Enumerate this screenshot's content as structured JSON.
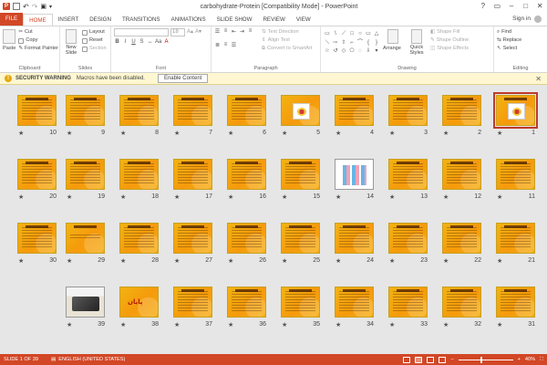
{
  "window": {
    "title": "carbohydrate-Protein [Compatibility Mode] - PowerPoint",
    "controls": [
      "?",
      "▭",
      "–",
      "□",
      "✕"
    ]
  },
  "tabs": [
    "FILE",
    "HOME",
    "INSERT",
    "DESIGN",
    "TRANSITIONS",
    "ANIMATIONS",
    "SLIDE SHOW",
    "REVIEW",
    "VIEW"
  ],
  "active_tab": "HOME",
  "account": {
    "signin": "Sign in"
  },
  "ribbon": {
    "clipboard": {
      "label": "Clipboard",
      "paste": "Paste",
      "cut": "Cut",
      "copy": "Copy",
      "format_painter": "Format Painter"
    },
    "slides": {
      "label": "Slides",
      "new_slide": "New Slide",
      "layout": "Layout",
      "reset": "Reset",
      "section": "Section"
    },
    "font": {
      "label": "Font",
      "size": "18"
    },
    "paragraph": {
      "label": "Paragraph",
      "text_direction": "Text Direction",
      "align_text": "Align Text",
      "convert_smartart": "Convert to SmartArt"
    },
    "drawing": {
      "label": "Drawing",
      "arrange": "Arrange",
      "quick_styles": "Quick Styles",
      "shape_fill": "Shape Fill",
      "shape_outline": "Shape Outline",
      "shape_effects": "Shape Effects"
    },
    "editing": {
      "label": "Editing",
      "find": "Find",
      "replace": "Replace",
      "select": "Select"
    }
  },
  "security_bar": {
    "title": "SECURITY WARNING",
    "message": "Macros have been disabled.",
    "button": "Enable Content"
  },
  "slides": [
    {
      "n": "1",
      "kind": "picture-title",
      "selected": true
    },
    {
      "n": "2",
      "kind": "text"
    },
    {
      "n": "3",
      "kind": "text"
    },
    {
      "n": "4",
      "kind": "text"
    },
    {
      "n": "5",
      "kind": "picture"
    },
    {
      "n": "6",
      "kind": "text"
    },
    {
      "n": "7",
      "kind": "text"
    },
    {
      "n": "8",
      "kind": "text"
    },
    {
      "n": "9",
      "kind": "text"
    },
    {
      "n": "10",
      "kind": "text"
    },
    {
      "n": "11",
      "kind": "text"
    },
    {
      "n": "12",
      "kind": "text"
    },
    {
      "n": "13",
      "kind": "text"
    },
    {
      "n": "14",
      "kind": "infographic"
    },
    {
      "n": "15",
      "kind": "text"
    },
    {
      "n": "16",
      "kind": "text"
    },
    {
      "n": "17",
      "kind": "text"
    },
    {
      "n": "18",
      "kind": "text"
    },
    {
      "n": "19",
      "kind": "text"
    },
    {
      "n": "20",
      "kind": "text"
    },
    {
      "n": "21",
      "kind": "text"
    },
    {
      "n": "22",
      "kind": "text"
    },
    {
      "n": "23",
      "kind": "text"
    },
    {
      "n": "24",
      "kind": "text"
    },
    {
      "n": "25",
      "kind": "text"
    },
    {
      "n": "26",
      "kind": "text"
    },
    {
      "n": "27",
      "kind": "text"
    },
    {
      "n": "28",
      "kind": "text"
    },
    {
      "n": "29",
      "kind": "title"
    },
    {
      "n": "30",
      "kind": "text"
    },
    {
      "n": "31",
      "kind": "text"
    },
    {
      "n": "32",
      "kind": "text"
    },
    {
      "n": "33",
      "kind": "text"
    },
    {
      "n": "34",
      "kind": "text"
    },
    {
      "n": "35",
      "kind": "text"
    },
    {
      "n": "36",
      "kind": "text"
    },
    {
      "n": "37",
      "kind": "text"
    },
    {
      "n": "38",
      "kind": "end",
      "caption": "پایان"
    },
    {
      "n": "39",
      "kind": "photo"
    }
  ],
  "status": {
    "slide_info": "SLIDE 1 OF 39",
    "language": "ENGLISH (UNITED STATES)",
    "zoom": "40%"
  },
  "colors": {
    "accent": "#d24726",
    "slide_bg": "#f5a20f",
    "security": "#fff7d1"
  }
}
